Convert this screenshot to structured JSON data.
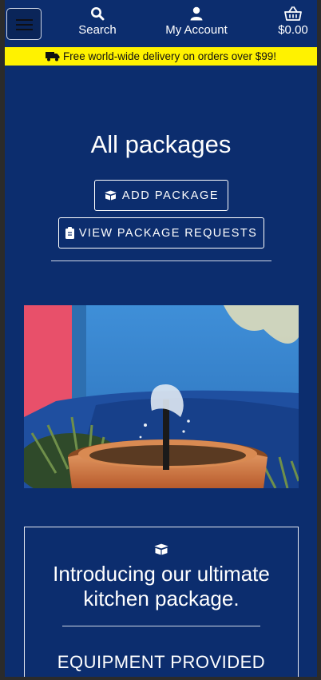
{
  "header": {
    "search_label": "Search",
    "account_label": "My Account",
    "cart_total": "$0.00"
  },
  "banner": {
    "text": "Free world-wide delivery on orders over $99!"
  },
  "main": {
    "title": "All packages",
    "add_package_label": "ADD PACKAGE",
    "view_requests_label": "VIEW PACKAGE REQUESTS"
  },
  "package_card": {
    "title": "Introducing our ultimate kitchen package.",
    "subtitle": "EQUIPMENT PROVIDED"
  },
  "colors": {
    "background": "#0c2d6e",
    "banner": "#fff200",
    "text": "#ffffff"
  },
  "icons": {
    "menu": "hamburger-icon",
    "search": "search-icon",
    "account": "user-icon",
    "cart": "shopping-basket-icon",
    "truck": "truck-icon",
    "box": "box-open-icon",
    "clipboard": "clipboard-icon"
  }
}
